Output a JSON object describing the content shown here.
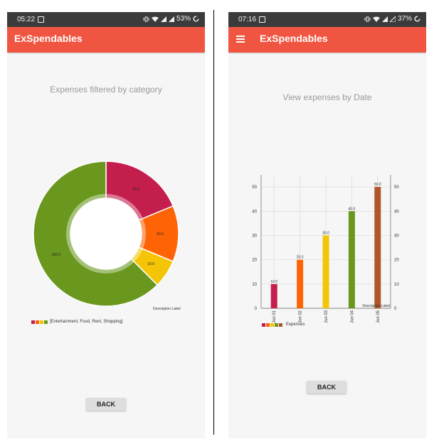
{
  "left": {
    "status": {
      "time": "05:22",
      "battery": "53%"
    },
    "app_title": "ExSpendables",
    "screen_title": "Expenses filtered by category",
    "description_label": "Description Label",
    "legend_text": "[Entertainment, Food, Rent, Shopping]",
    "back_label": "BACK",
    "colors": [
      "#c41f4c",
      "#fe6405",
      "#f4c506",
      "#6a981e"
    ]
  },
  "right": {
    "status": {
      "time": "07:16",
      "battery": "37%"
    },
    "app_title": "ExSpendables",
    "screen_title": "View expenses by Date",
    "description_label": "Description Label",
    "legend_text": "Expenses",
    "back_label": "BACK",
    "colors": [
      "#c41f4c",
      "#fe6405",
      "#f4c506",
      "#6a981e",
      "#b0572a"
    ]
  },
  "chart_data": [
    {
      "type": "pie",
      "categories": [
        "Entertainment",
        "Food",
        "Rent",
        "Shopping"
      ],
      "values": [
        30,
        20,
        10,
        100
      ],
      "value_labels": [
        "30.0",
        "20.0",
        "10.0",
        "100.0"
      ],
      "colors": [
        "#c41f4c",
        "#fe6405",
        "#f4c506",
        "#6a981e"
      ],
      "title": "Expenses filtered by category",
      "legend": "[Entertainment, Food, Rent, Shopping]",
      "donut": true
    },
    {
      "type": "bar",
      "categories": [
        "Jun 01",
        "Jun 02",
        "Jun 03",
        "Jun 04",
        "Jun 05"
      ],
      "values": [
        10,
        20,
        30,
        40,
        50
      ],
      "value_labels": [
        "10.0",
        "20.0",
        "30.0",
        "40.0",
        "50.0"
      ],
      "colors": [
        "#c41f4c",
        "#fe6405",
        "#f4c506",
        "#6a981e",
        "#b0572a"
      ],
      "series": [
        {
          "name": "Expenses",
          "values": [
            10,
            20,
            30,
            40,
            50
          ]
        }
      ],
      "title": "View expenses by Date",
      "ylim": [
        0,
        55
      ],
      "yticks": [
        0,
        10,
        20,
        30,
        40,
        50
      ],
      "grid": true
    }
  ]
}
